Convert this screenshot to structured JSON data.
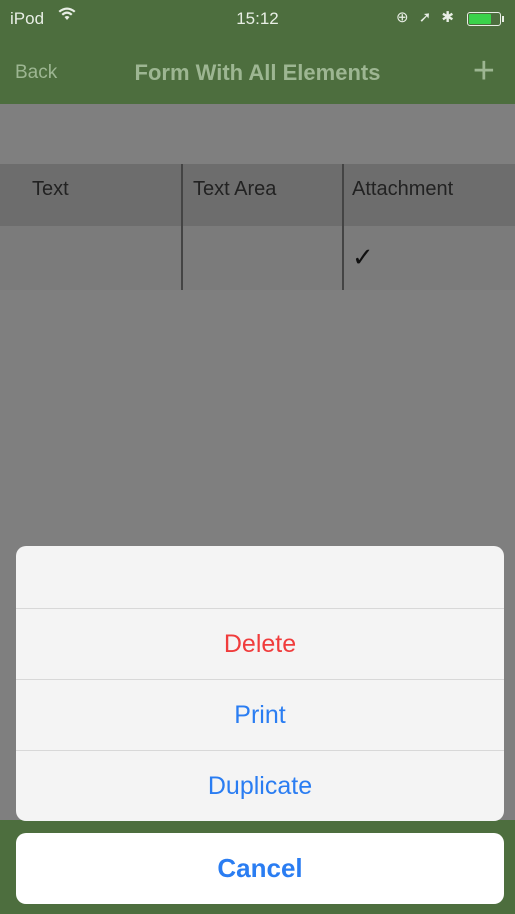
{
  "status_bar": {
    "carrier": "iPod",
    "wifi_icon": "wifi-icon",
    "time": "15:12",
    "indicators": "⊕ ➚ ✱",
    "battery_level": 0.7
  },
  "nav": {
    "back_label": "Back",
    "title": "Form With All Elements",
    "add_icon": "plus-icon",
    "add_glyph": "+"
  },
  "table": {
    "columns": [
      "Text",
      "Text Area",
      "Attachment"
    ],
    "rows": [
      {
        "text": "",
        "text_area": "",
        "attachment_checked": true,
        "check_glyph": "✓"
      }
    ]
  },
  "action_sheet": {
    "items": [
      {
        "label": "Delete",
        "style": "destructive"
      },
      {
        "label": "Print",
        "style": "default"
      },
      {
        "label": "Duplicate",
        "style": "default"
      }
    ],
    "cancel_label": "Cancel"
  },
  "colors": {
    "nav_green": "#4d6e3e",
    "action_blue": "#2a7df2",
    "destructive_red": "#f03c3c"
  }
}
